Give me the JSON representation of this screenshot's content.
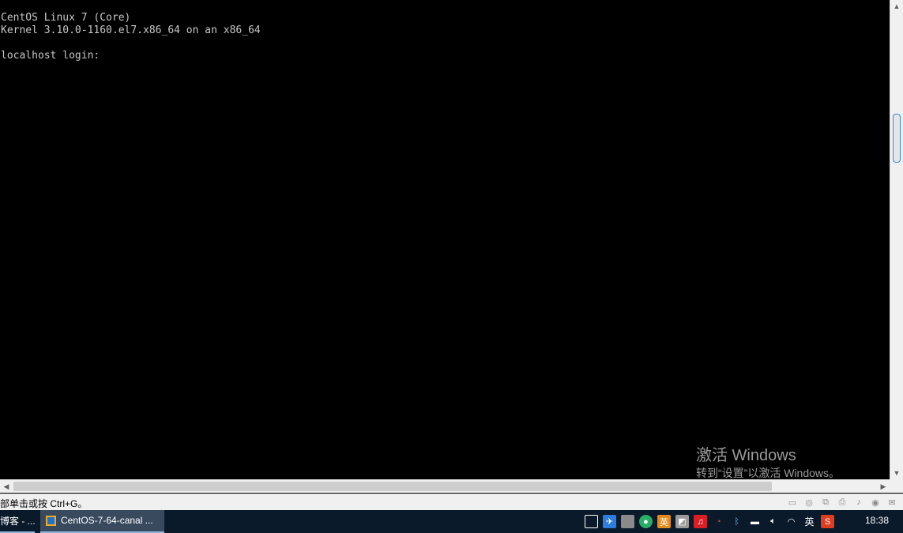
{
  "console": {
    "lines": [
      "CentOS Linux 7 (Core)",
      "Kernel 3.10.0-1160.el7.x86_64 on an x86_64",
      "",
      "localhost login:"
    ]
  },
  "watermark": {
    "title": "激活 Windows",
    "subtitle": "转到“设置”以激活 Windows。"
  },
  "statusbar": {
    "text": "部单击或按 Ctrl+G。",
    "device_icons": [
      "hard-disk-icon",
      "cd-drive-icon",
      "network-adapter-icon",
      "printer-icon",
      "sound-card-icon",
      "usb-icon",
      "message-icon"
    ]
  },
  "taskbar": {
    "tasks": [
      {
        "label": "博客 - ...",
        "icon": ""
      },
      {
        "label": "CentOS-7-64-canal ...",
        "icon": "vmware-icon"
      }
    ],
    "tray_icons": [
      "action-center-icon",
      "feishu-icon",
      "window-icon",
      "wechat-icon",
      "ime-icon",
      "app-icon",
      "qq-music-icon",
      "weibo-icon",
      "bluetooth-icon",
      "battery-icon",
      "volume-icon",
      "wifi-icon"
    ],
    "ime_label": "英",
    "clock": "18:38"
  }
}
